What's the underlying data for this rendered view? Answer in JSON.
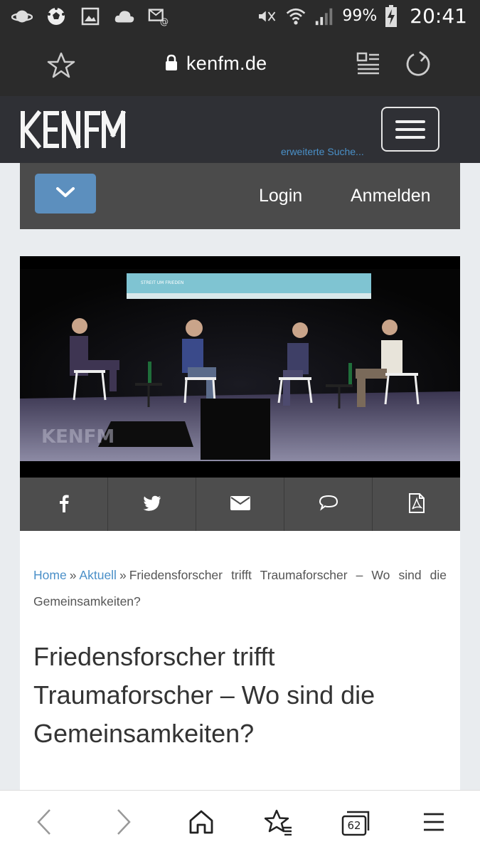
{
  "status_bar": {
    "battery": "99%",
    "time": "20:41",
    "left_icons": [
      "planet-icon",
      "soccer-ball-icon",
      "image-icon",
      "cloud-icon",
      "email-notification-icon"
    ],
    "right_icons": [
      "mute-icon",
      "wifi-icon",
      "signal-icon",
      "battery-charging-icon"
    ]
  },
  "browser": {
    "url": "kenfm.de",
    "tabs_count": "62"
  },
  "site": {
    "logo_text": "KENFM",
    "extended_search": "erweiterte Suche..."
  },
  "login_bar": {
    "login": "Login",
    "register": "Anmelden"
  },
  "hero": {
    "watermark": "KENFM",
    "screen_text": "STREIT UM FRIEDEN"
  },
  "share": {
    "items": [
      "facebook-icon",
      "twitter-icon",
      "email-icon",
      "comment-icon",
      "pdf-icon"
    ]
  },
  "breadcrumb": {
    "home": "Home",
    "separator": "»",
    "category": "Aktuell",
    "current": "Friedensforscher trifft Traumaforscher – Wo sind die Gemeinsamkeiten?"
  },
  "article": {
    "title": "Friedensforscher trifft Traumaforscher – Wo sind die Gemeinsamkeiten?"
  },
  "colors": {
    "accent": "#5c8fbe",
    "link": "#4a8fc8",
    "header_bg": "#2f3035"
  }
}
